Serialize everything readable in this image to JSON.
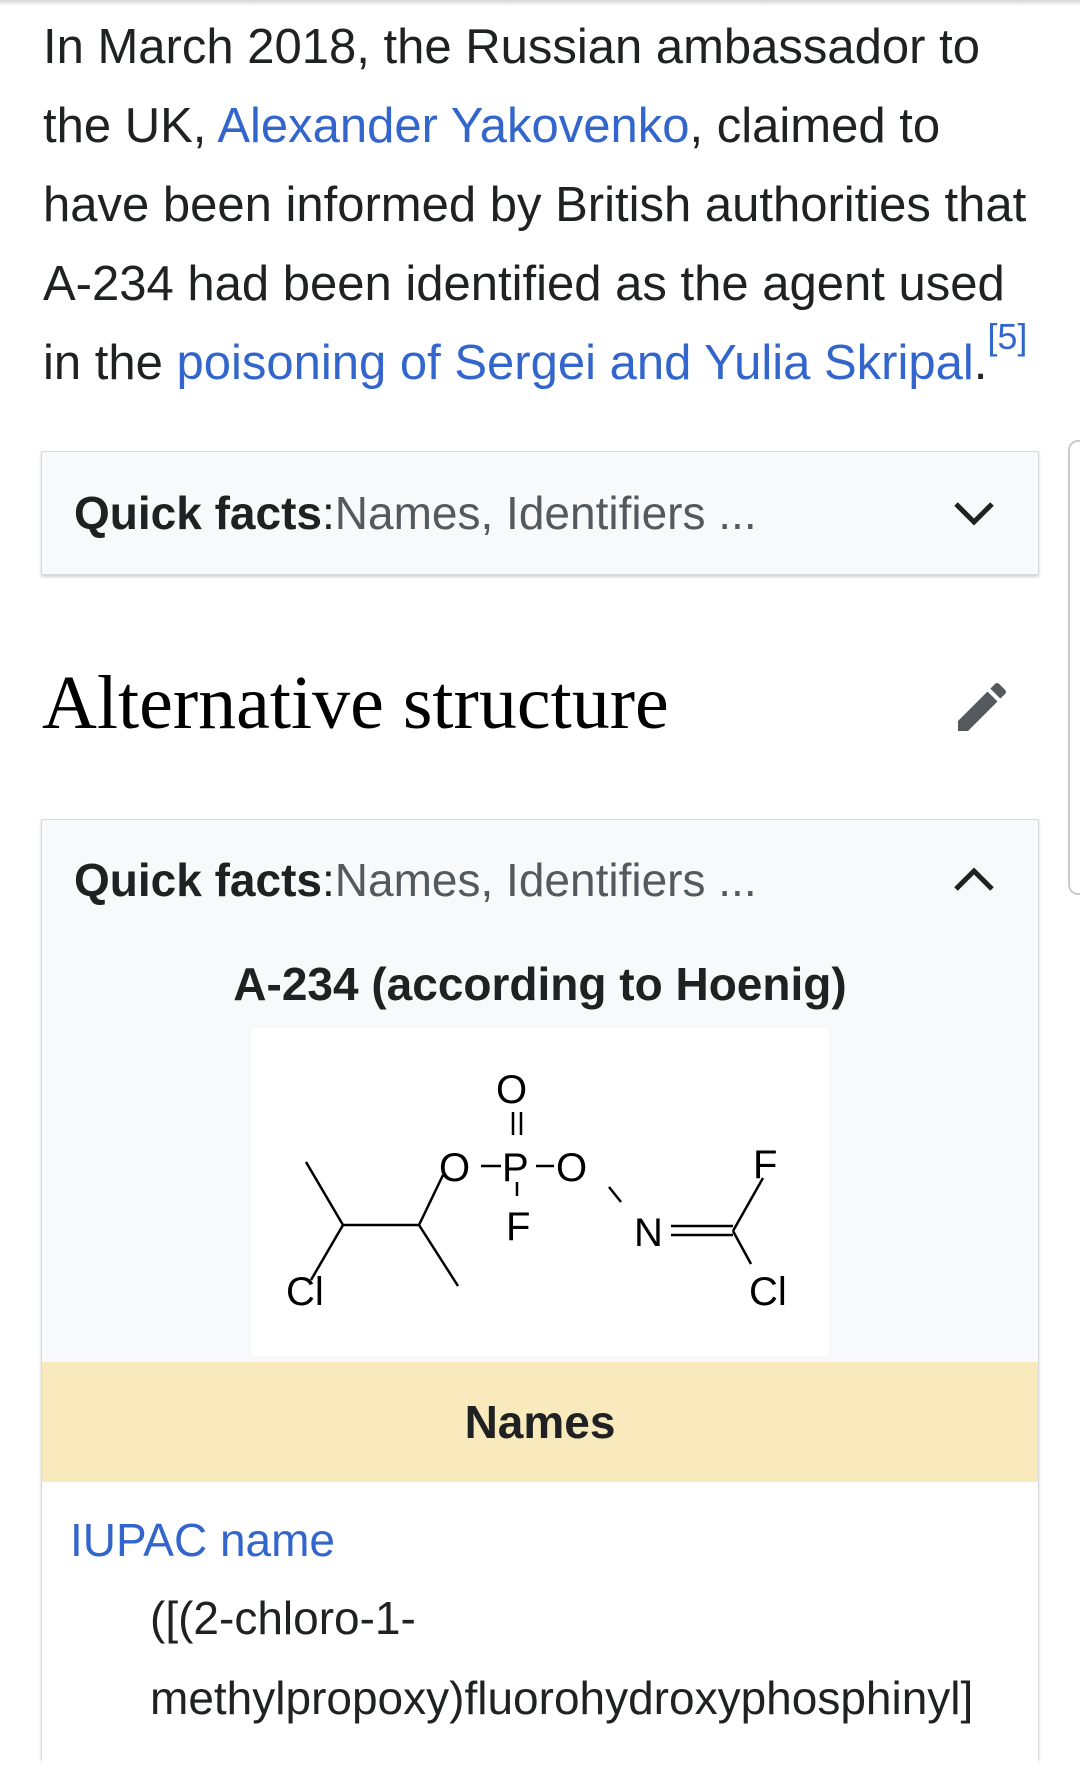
{
  "paragraph": {
    "part1": "In March 2018, the Russian ambassador to",
    "part2": "the UK, ",
    "link_ambassador": "Alexander Yakovenko",
    "part3": ", claimed to",
    "part4": "have been informed by British authorities that",
    "part5": "A-234 had been identified as the agent used",
    "part6": "in the ",
    "link_poisoning": "poisoning of Sergei and Yulia Skripal",
    "part7": ".",
    "ref": "[5]"
  },
  "quick_facts_collapsed": {
    "label": "Quick facts",
    "sep": ":",
    "summary": " Names, Identifiers ..."
  },
  "section": {
    "title": "Alternative structure"
  },
  "quick_facts_expanded": {
    "label": "Quick facts",
    "sep": ":",
    "summary": " Names, Identifiers ...",
    "caption": "A-234 (according to Hoenig)",
    "molecule_atoms": {
      "o_top": "O",
      "o_left": "O",
      "p": "P",
      "o_right": "O",
      "f_right": "F",
      "f_bottom": "F",
      "n": "N",
      "cl_left": "Cl",
      "cl_right": "Cl"
    },
    "names_header": "Names",
    "iupac_label": "IUPAC name",
    "iupac_line1": "([(2-chloro-1-",
    "iupac_line2": "methylpropoxy)fluorohydroxyphosphinyl]"
  },
  "icons": {
    "collapsed_chevron": "chevron-down-icon",
    "expanded_chevron": "chevron-up-icon",
    "edit": "pencil-icon"
  }
}
